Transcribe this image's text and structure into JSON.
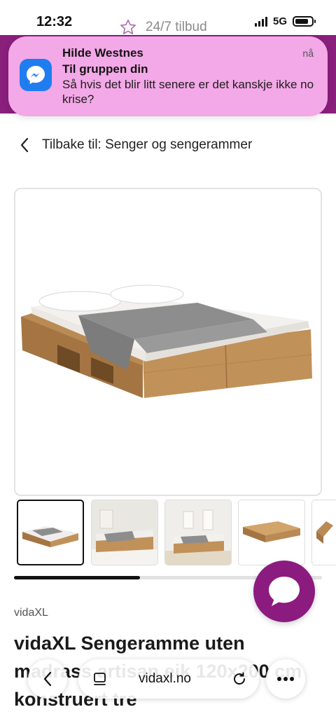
{
  "status_bar": {
    "time": "12:32",
    "network": "5G"
  },
  "site": {
    "promo_text": "24/7 tilbud"
  },
  "notification": {
    "sender": "Hilde Westnes",
    "time": "nå",
    "subtitle": "Til gruppen din",
    "body": "Så hvis det blir litt senere er det kanskje ikke no krise?",
    "app_icon": "messenger-icon"
  },
  "navigation": {
    "back_label": "Tilbake til: Senger og sengerammer"
  },
  "gallery": {
    "main_image_alt": "vidaXL Sengeramme",
    "thumbnail_count": 5,
    "active_thumbnail": 1,
    "scroll_progress": 0.41
  },
  "product": {
    "brand": "vidaXL",
    "title": "vidaXL Sengeramme uten madrass artisan eik 120x200 cm konstruert tre"
  },
  "browser": {
    "url": "vidaxl.no"
  },
  "colors": {
    "brand_purple": "#8a1f7c",
    "notification_bg": "#f3a8e7",
    "messenger_blue": "#1f7df0"
  }
}
